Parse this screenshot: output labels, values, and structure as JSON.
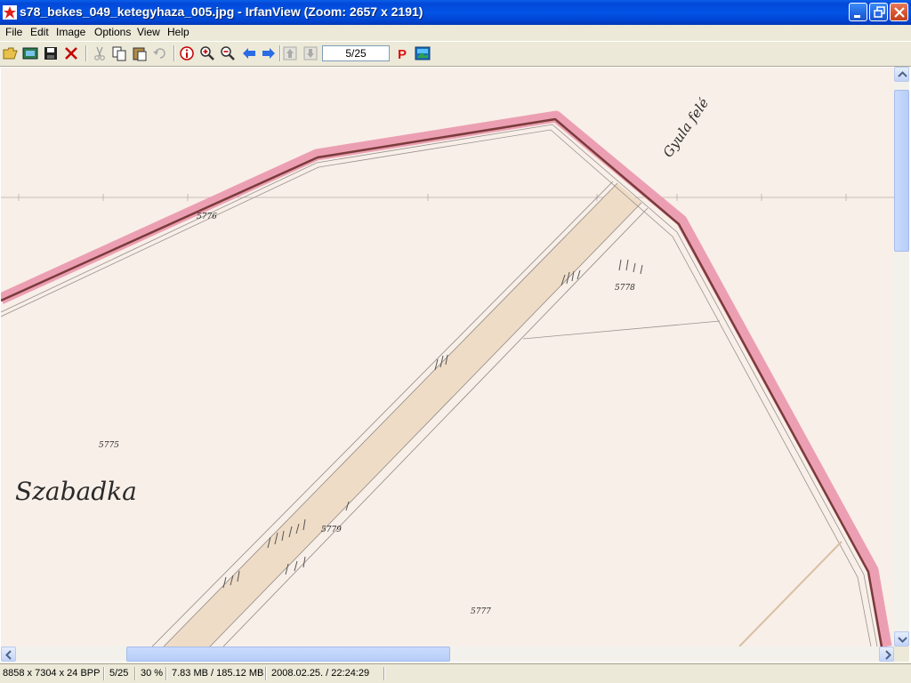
{
  "window": {
    "title": "s78_bekes_049_ketegyhaza_005.jpg - IrfanView (Zoom: 2657 x 2191)"
  },
  "menu": {
    "items": [
      "File",
      "Edit",
      "Image",
      "Options",
      "View",
      "Help"
    ]
  },
  "toolbar": {
    "icons": [
      "open-folder-icon",
      "slideshow-icon",
      "save-icon",
      "delete-icon",
      "cut-icon",
      "copy-icon",
      "paste-icon",
      "undo-icon",
      "info-icon",
      "zoom-in-icon",
      "zoom-out-icon",
      "previous-arrow-icon",
      "next-arrow-icon",
      "up-icon",
      "down-icon",
      "print-icon",
      "image-icon"
    ],
    "page_value": "5/25"
  },
  "map": {
    "place_label": "Szabadka",
    "edge_label": "Gyula felé",
    "parcel_labels": [
      "5775",
      "5778",
      "5777",
      "5779",
      "5776"
    ]
  },
  "statusbar": {
    "dimensions": "8858 x 7304 x 24 BPP",
    "page": "5/25",
    "zoom": "30 %",
    "memory": "7.83 MB / 185.12 MB",
    "datetime": "2008.02.25. / 22:24:29"
  },
  "colors": {
    "title_bar": "#0254e6",
    "map_paper": "#f8efe8",
    "border_pink": "#e78fa6",
    "border_dark": "#7a3b3b",
    "road_fill": "#efdcc6"
  }
}
